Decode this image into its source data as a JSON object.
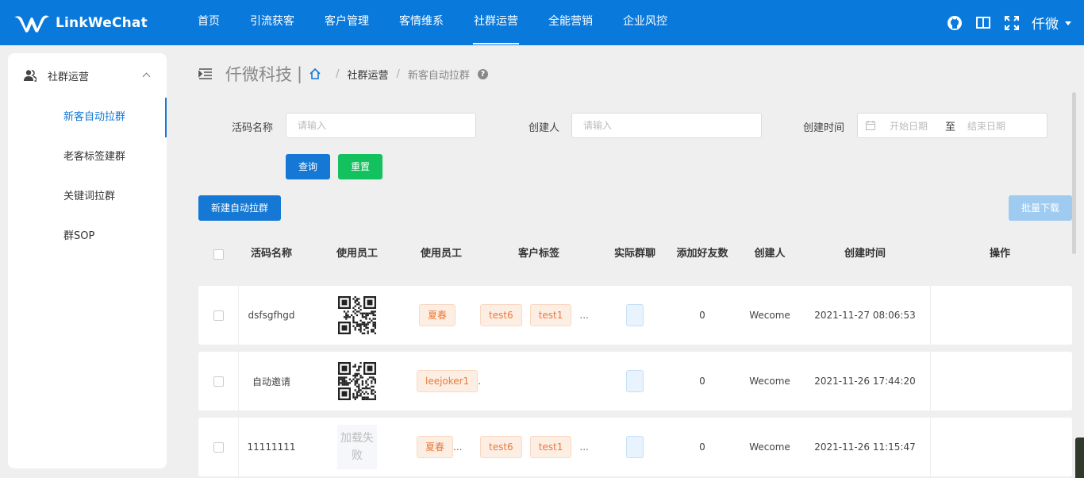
{
  "brand": {
    "name": "LinkWeChat"
  },
  "nav": {
    "items": [
      {
        "label": "首页"
      },
      {
        "label": "引流获客"
      },
      {
        "label": "客户管理"
      },
      {
        "label": "客情维系"
      },
      {
        "label": "社群运营"
      },
      {
        "label": "全能营销"
      },
      {
        "label": "企业风控"
      }
    ],
    "active_index": 4,
    "user": "仟微",
    "icons": [
      "github-icon",
      "book-icon",
      "fullscreen-icon"
    ]
  },
  "sidebar": {
    "group_label": "社群运营",
    "items": [
      {
        "label": "新客自动拉群"
      },
      {
        "label": "老客标签建群"
      },
      {
        "label": "关键词拉群"
      },
      {
        "label": "群SOP"
      }
    ],
    "active_index": 0
  },
  "breadcrumb": {
    "company": "仟微科技",
    "separator": "|",
    "slash": "/",
    "current": "社群运营",
    "last": "新客自动拉群",
    "help": "?"
  },
  "filters": {
    "code_name_label": "活码名称",
    "code_name_placeholder": "请输入",
    "creator_label": "创建人",
    "creator_placeholder": "请输入",
    "created_time_label": "创建时间",
    "start_placeholder": "开始日期",
    "range_separator": "至",
    "end_placeholder": "结束日期",
    "query_label": "查询",
    "reset_label": "重置"
  },
  "actions": {
    "new_label": "新建自动拉群",
    "batch_download_label": "批量下载"
  },
  "table": {
    "headers": {
      "code_name": "活码名称",
      "employee_qr": "使用员工",
      "employee": "使用员工",
      "customer_tags": "客户标签",
      "actual_group": "实际群聊",
      "friends_added": "添加好友数",
      "creator": "创建人",
      "created_time": "创建时间",
      "operations": "操作"
    },
    "rows": [
      {
        "name": "dsfsgfhgd",
        "qr": "qr",
        "employee": "夏春",
        "employee_more": "",
        "tags": [
          "test6",
          "test1"
        ],
        "tags_more": "...",
        "friends": "0",
        "creator": "Wecome",
        "time": "2021-11-27 08:06:53"
      },
      {
        "name": "自动邀请",
        "qr": "qr",
        "employee": "leejoker1",
        "employee_more": ".",
        "tags": [],
        "tags_more": "",
        "friends": "0",
        "creator": "Wecome",
        "time": "2021-11-26 17:44:20"
      },
      {
        "name": "11111111",
        "qr": "fail",
        "qr_fail_text": "加载失败",
        "employee": "夏春",
        "employee_more": "...",
        "tags": [
          "test6",
          "test1"
        ],
        "tags_more": "...",
        "friends": "0",
        "creator": "Wecome",
        "time": "2021-11-26 11:15:47"
      }
    ]
  },
  "colors": {
    "primary": "#1478d4",
    "topbar": "#0979dc",
    "success": "#13c15f",
    "tag_text": "#ea7b3a",
    "tag_bg": "#fdeee4"
  }
}
